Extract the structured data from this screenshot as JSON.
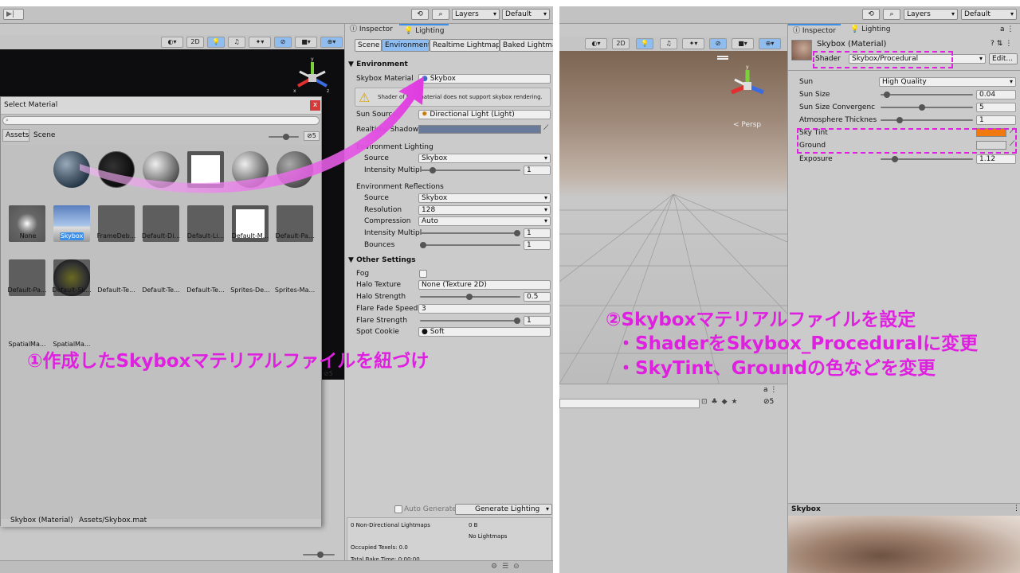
{
  "colors": {
    "accent": "#e020e0",
    "unity_blue": "#3b8ee8",
    "panel": "#cbcbcb",
    "sky_tint": "#f07a10"
  },
  "left_window": {
    "toolbar": {
      "layers": "Layers",
      "layout": "Default"
    },
    "scene_toolbar": {
      "btn_2d": "2D"
    },
    "inspector_tab": "Inspector",
    "lighting_tab": "Lighting",
    "lighting_tabs": [
      "Scene",
      "Environment",
      "Realtime Lightmaps",
      "Baked Lightma"
    ],
    "environment": {
      "header": "Environment",
      "skybox_material_label": "Skybox Material",
      "skybox_material_value": "Skybox",
      "warning": "Shader of this material does not support skybox rendering.",
      "sun_source_label": "Sun Source",
      "sun_source_value": "Directional Light (Light)",
      "realtime_shadow_label": "Realtime Shadow Color",
      "env_lighting_header": "Environment Lighting",
      "source_label": "Source",
      "source_value": "Skybox",
      "intensity_label": "Intensity Multipl",
      "intensity_value": "1",
      "env_reflections_header": "Environment Reflections",
      "refl_source_label": "Source",
      "refl_source_value": "Skybox",
      "resolution_label": "Resolution",
      "resolution_value": "128",
      "compression_label": "Compression",
      "compression_value": "Auto",
      "refl_intensity_label": "Intensity Multipl",
      "refl_intensity_value": "1",
      "bounces_label": "Bounces",
      "bounces_value": "1"
    },
    "other_settings": {
      "header": "Other Settings",
      "fog_label": "Fog",
      "halo_texture_label": "Halo Texture",
      "halo_texture_value": "None (Texture 2D)",
      "halo_strength_label": "Halo Strength",
      "halo_strength_value": "0.5",
      "flare_fade_label": "Flare Fade Speed",
      "flare_fade_value": "3",
      "flare_strength_label": "Flare Strength",
      "flare_strength_value": "1",
      "spot_cookie_label": "Spot Cookie",
      "spot_cookie_value": "Soft"
    },
    "bake": {
      "auto_generate": "Auto Generate",
      "generate_button": "Generate Lighting",
      "stats_lightmaps": "0 Non-Directional Lightmaps",
      "stats_size": "0 B",
      "stats_none": "No Lightmaps",
      "occupied_texels": "Occupied Texels: 0.0",
      "bake_time": "Total Bake Time: 0:00:00"
    },
    "select_material": {
      "title": "Select Material",
      "close": "x",
      "tab_assets": "Assets",
      "tab_scene": "Scene",
      "count": "5",
      "items": [
        "None",
        "Skybox",
        "FrameDeb...",
        "Default-Di...",
        "Default-Li...",
        "Default-M...",
        "Default-Pa...",
        "Default-Pa...",
        "Default-Sk...",
        "Default-Te...",
        "Default-Te...",
        "Default-Te...",
        "Sprites-De...",
        "Sprites-Ma...",
        "SpatialMa...",
        "SpatialMa..."
      ],
      "footer_name": "Skybox (Material)",
      "footer_path": "Assets/Skybox.mat"
    }
  },
  "right_window": {
    "toolbar": {
      "layers": "Layers",
      "layout": "Default"
    },
    "scene_toolbar": {
      "btn_2d": "2D"
    },
    "persp": "< Persp",
    "inspector_tab": "Inspector",
    "lighting_tab": "Lighting",
    "material_title": "Skybox (Material)",
    "shader_label": "Shader",
    "shader_value": "Skybox/Procedural",
    "edit_button": "Edit...",
    "props": {
      "sun_label": "Sun",
      "sun_value": "High Quality",
      "sun_size_label": "Sun Size",
      "sun_size_value": "0.04",
      "sun_conv_label": "Sun Size Convergenc",
      "sun_conv_value": "5",
      "atmo_label": "Atmosphere Thicknes",
      "atmo_value": "1",
      "sky_tint_label": "Sky Tint",
      "ground_label": "Ground",
      "exposure_label": "Exposure",
      "exposure_value": "1.12"
    },
    "preview_title": "Skybox",
    "count": "5"
  },
  "annotations": {
    "step1": "①作成したSkyboxマテリアルファイルを紐づけ",
    "step2_title": "②Skyboxマテリアルファイルを設定",
    "step2_line1": "・ShaderをSkybox_Proceduralに変更",
    "step2_line2": "・SkyTint、Groundの色などを変更"
  }
}
